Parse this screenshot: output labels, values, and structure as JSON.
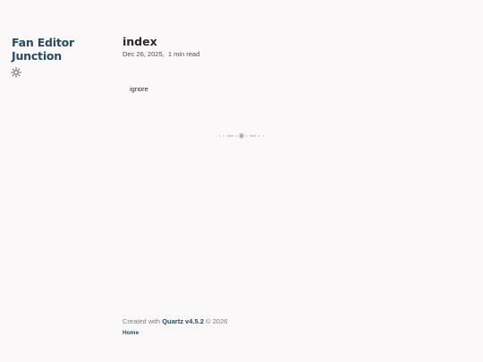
{
  "site": {
    "title": "Fan Editor Junction"
  },
  "theme_toggle": {
    "icon": "sun-icon"
  },
  "article": {
    "title": "index",
    "date": "Dec 26, 2025",
    "separator": ",",
    "reading_time": "1 min read",
    "body_text": "ignore"
  },
  "divider": {
    "icon": "ornamental-divider-icon"
  },
  "footer": {
    "created_with": "Created with",
    "brand": "Quartz v4.5.2",
    "copyright": "© 2026",
    "links": [
      {
        "label": "Home"
      }
    ]
  },
  "colors": {
    "accent": "#284b63",
    "background": "#faf8f8",
    "text": "#2b2b2b",
    "muted": "#7b7b7b"
  }
}
